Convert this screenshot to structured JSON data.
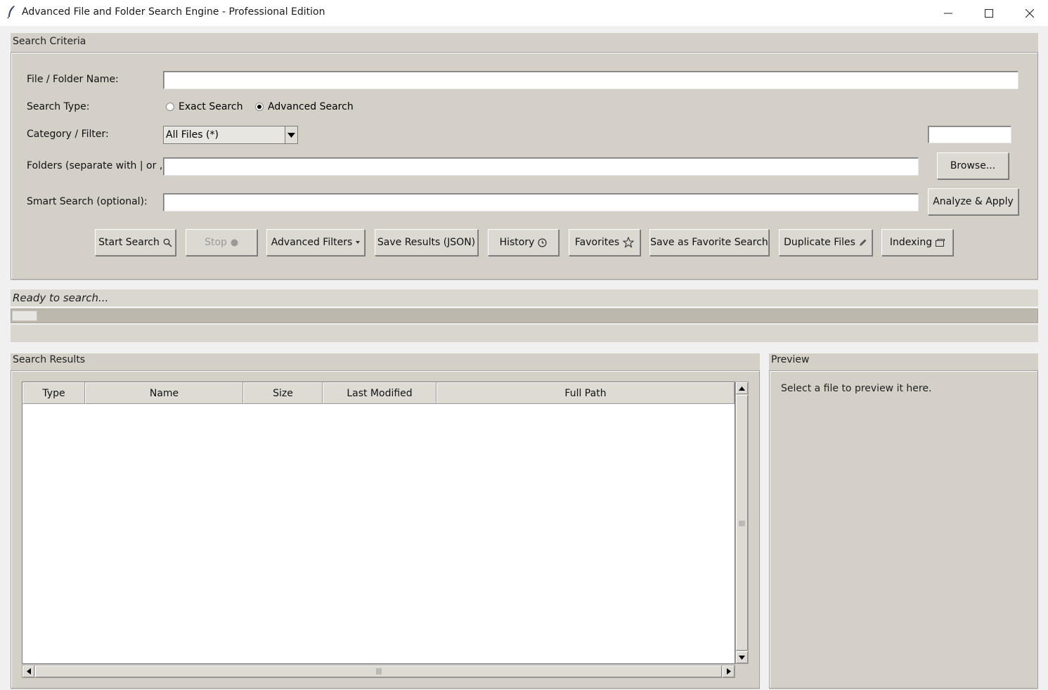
{
  "window": {
    "title": "Advanced File and Folder Search Engine - Professional Edition",
    "icon": "feather-icon",
    "controls": [
      "minimize-icon",
      "maximize-icon",
      "close-icon"
    ]
  },
  "criteria": {
    "group_label": "Search Criteria",
    "name_label": "File / Folder Name:",
    "name_value": "",
    "type_label": "Search Type:",
    "radio_exact": "Exact Search",
    "radio_advanced": "Advanced Search",
    "selected_type": "Advanced Search",
    "category_label": "Category / Filter:",
    "category_value": "All Files (*)",
    "extra_filter_value": "",
    "folders_label": "Folders (separate with | or ,):",
    "folders_value": "",
    "browse_button": "Browse...",
    "smart_label": "Smart Search (optional):",
    "smart_value": "",
    "analyze_button": "Analyze & Apply"
  },
  "toolbar": {
    "start": "Start Search",
    "stop": "Stop",
    "advanced_filters": "Advanced Filters",
    "save_json": "Save Results (JSON)",
    "history": "History",
    "favorites": "Favorites",
    "save_favorite": "Save as Favorite Search",
    "duplicates": "Duplicate Files",
    "indexing": "Indexing"
  },
  "status": {
    "text": "Ready to search...",
    "progress": 0.025
  },
  "results": {
    "group_label": "Search Results",
    "columns": [
      "Type",
      "Name",
      "Size",
      "Last Modified",
      "Full Path"
    ],
    "rows": []
  },
  "preview": {
    "group_label": "Preview",
    "placeholder": "Select a file to preview it here."
  },
  "colors": {
    "panel": "#d4d0c8",
    "window": "#f0f0f0"
  }
}
